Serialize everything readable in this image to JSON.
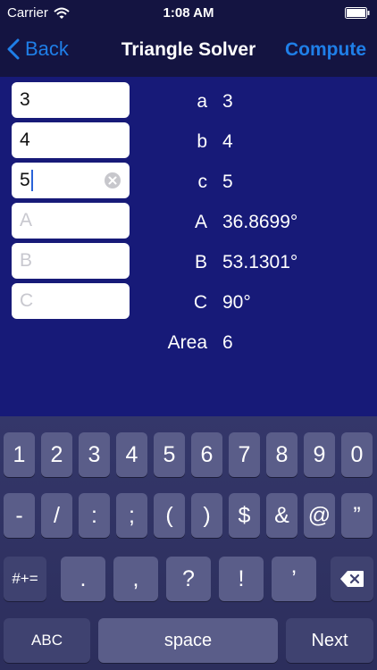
{
  "status_bar": {
    "carrier": "Carrier",
    "time": "1:08 AM"
  },
  "nav": {
    "back": "Back",
    "title": "Triangle Solver",
    "compute": "Compute"
  },
  "inputs": {
    "a": {
      "value": "3",
      "placeholder": ""
    },
    "b": {
      "value": "4",
      "placeholder": ""
    },
    "c": {
      "value": "5",
      "placeholder": ""
    },
    "A": {
      "value": "",
      "placeholder": "A"
    },
    "B": {
      "value": "",
      "placeholder": "B"
    },
    "C": {
      "value": "",
      "placeholder": "C"
    }
  },
  "results": [
    {
      "label": "a",
      "value": "3"
    },
    {
      "label": "b",
      "value": "4"
    },
    {
      "label": "c",
      "value": "5"
    },
    {
      "label": "A",
      "value": "36.8699°"
    },
    {
      "label": "B",
      "value": "53.1301°"
    },
    {
      "label": "C",
      "value": "90°"
    },
    {
      "label": "Area",
      "value": "6"
    }
  ],
  "keyboard": {
    "row1": [
      "1",
      "2",
      "3",
      "4",
      "5",
      "6",
      "7",
      "8",
      "9",
      "0"
    ],
    "row2": [
      "-",
      "/",
      ":",
      ";",
      "(",
      ")",
      "$",
      "&",
      "@",
      "”"
    ],
    "row3": {
      "toggle": "#+=",
      "keys": [
        ".",
        ",",
        "?",
        "!",
        "’"
      ]
    },
    "row4": {
      "abc": "ABC",
      "space": "space",
      "next": "Next"
    }
  },
  "colors": {
    "nav_background": "#141441",
    "content_background": "#171a78",
    "accent": "#1f7fe8"
  }
}
